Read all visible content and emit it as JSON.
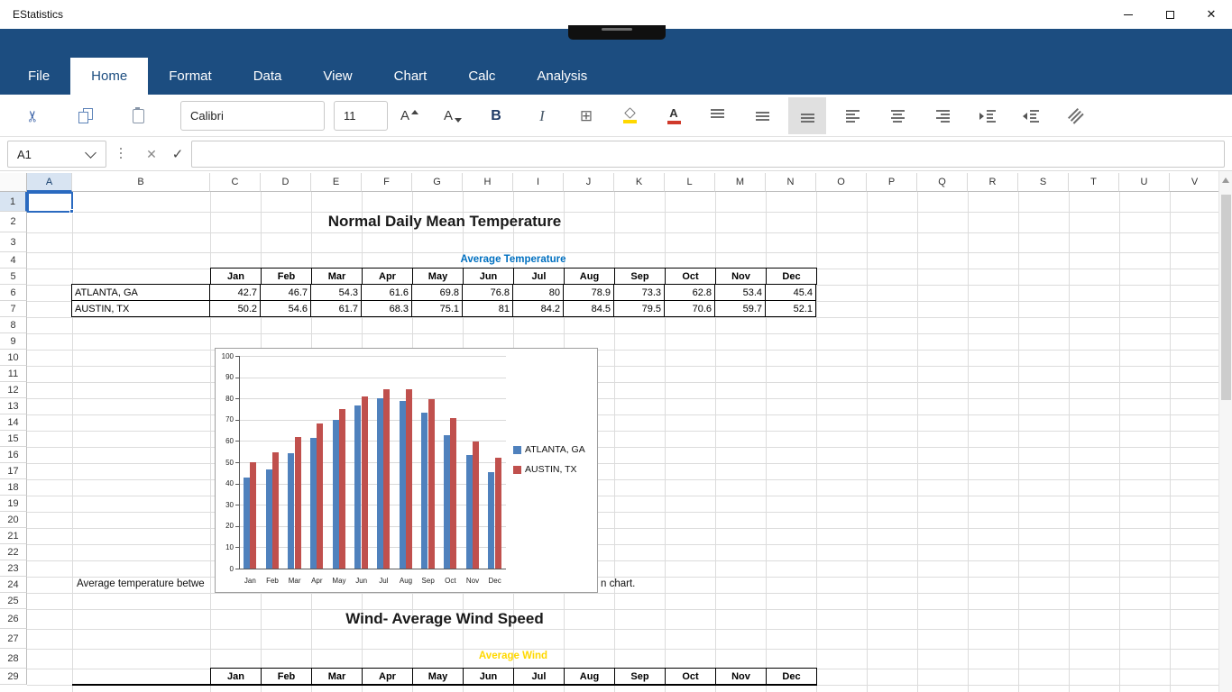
{
  "titlebar": {
    "title": "EStatistics"
  },
  "menu": {
    "tabs": [
      {
        "label": "File",
        "active": false
      },
      {
        "label": "Home",
        "active": true
      },
      {
        "label": "Format",
        "active": false
      },
      {
        "label": "Data",
        "active": false
      },
      {
        "label": "View",
        "active": false
      },
      {
        "label": "Chart",
        "active": false
      },
      {
        "label": "Calc",
        "active": false
      },
      {
        "label": "Analysis",
        "active": false
      }
    ]
  },
  "toolbar": {
    "font_name": "Calibri",
    "font_size": "11"
  },
  "icons": {
    "cut": "✂",
    "borders": "⊞",
    "bold": "B",
    "italic": "I",
    "letter_A": "A",
    "font_color": "A",
    "cancel": "✕",
    "enter": "✓",
    "close": "✕"
  },
  "name_box": {
    "value": "A1"
  },
  "formula_bar": {
    "value": ""
  },
  "grid": {
    "columns": [
      "A",
      "B",
      "C",
      "D",
      "E",
      "F",
      "G",
      "H",
      "I",
      "J",
      "K",
      "L",
      "M",
      "N",
      "O",
      "P",
      "Q",
      "R",
      "S",
      "T",
      "U",
      "V"
    ],
    "rows": [
      1,
      2,
      3,
      4,
      5,
      6,
      7,
      8,
      9,
      10,
      11,
      12,
      13,
      14,
      15,
      16,
      17,
      18,
      19,
      20,
      21,
      22,
      23,
      24,
      25,
      26,
      27,
      28,
      29
    ],
    "selected_cell": "A1",
    "selected_column": "A",
    "selected_row": 1
  },
  "sheet": {
    "title1": "Normal Daily Mean Temperature",
    "subtitle1": "Average Temperature",
    "months": [
      "Jan",
      "Feb",
      "Mar",
      "Apr",
      "May",
      "Jun",
      "Jul",
      "Aug",
      "Sep",
      "Oct",
      "Nov",
      "Dec"
    ],
    "table1": {
      "rows": [
        {
          "label": "ATLANTA, GA",
          "values": [
            "42.7",
            "46.7",
            "54.3",
            "61.6",
            "69.8",
            "76.8",
            "80",
            "78.9",
            "73.3",
            "62.8",
            "53.4",
            "45.4"
          ]
        },
        {
          "label": "AUSTIN, TX",
          "values": [
            "50.2",
            "54.6",
            "61.7",
            "68.3",
            "75.1",
            "81",
            "84.2",
            "84.5",
            "79.5",
            "70.6",
            "59.7",
            "52.1"
          ]
        }
      ]
    },
    "caption_left": "Average temperature betwe",
    "caption_right": "n chart.",
    "title2": "Wind- Average Wind Speed",
    "subtitle2": "Average Wind"
  },
  "chart_data": {
    "type": "bar",
    "title": "",
    "categories": [
      "Jan",
      "Feb",
      "Mar",
      "Apr",
      "May",
      "Jun",
      "Jul",
      "Aug",
      "Sep",
      "Oct",
      "Nov",
      "Dec"
    ],
    "series": [
      {
        "name": "ATLANTA, GA",
        "color": "#4F81BD",
        "values": [
          42.7,
          46.7,
          54.3,
          61.6,
          69.8,
          76.8,
          80,
          78.9,
          73.3,
          62.8,
          53.4,
          45.4
        ]
      },
      {
        "name": "AUSTIN, TX",
        "color": "#C0504D",
        "values": [
          50.2,
          54.6,
          61.7,
          68.3,
          75.1,
          81,
          84.2,
          84.5,
          79.5,
          70.6,
          59.7,
          52.1
        ]
      }
    ],
    "ylim": [
      0,
      100
    ],
    "ytick_step": 10,
    "grid": true,
    "legend_position": "right"
  },
  "colors": {
    "ribbon": "#1c4d80",
    "accent": "#2a6ac0",
    "selection_fill": "#d8e4f2",
    "subtitle1_blue": "#0070C0",
    "subtitle2_yellow": "#ffd800",
    "series1": "#4F81BD",
    "series2": "#C0504D",
    "fill_bar": "#ffd800",
    "font_color_bar": "#d03a2b"
  }
}
